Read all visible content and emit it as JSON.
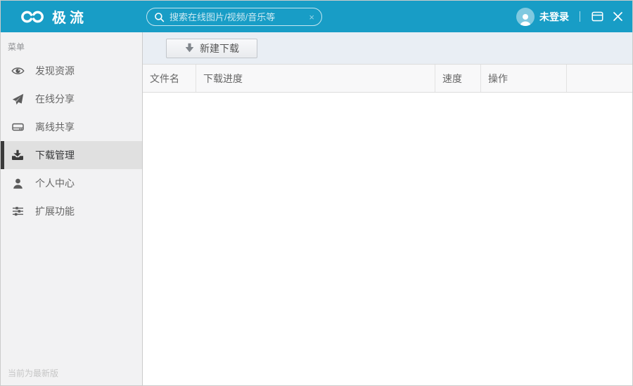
{
  "topbar": {
    "brand": "极流",
    "search": {
      "placeholder": "搜索在线图片/视频/音乐等",
      "clear_glyph": "×"
    },
    "login_label": "未登录"
  },
  "sidebar": {
    "section_label": "菜单",
    "items": [
      {
        "label": "发现资源",
        "icon": "eye-icon",
        "selected": false
      },
      {
        "label": "在线分享",
        "icon": "paper-plane-icon",
        "selected": false
      },
      {
        "label": "离线共享",
        "icon": "hard-drive-icon",
        "selected": false
      },
      {
        "label": "下载管理",
        "icon": "download-icon",
        "selected": true
      },
      {
        "label": "个人中心",
        "icon": "user-icon",
        "selected": false
      },
      {
        "label": "扩展功能",
        "icon": "sliders-icon",
        "selected": false
      }
    ],
    "footer_status": "当前为最新版"
  },
  "toolbar": {
    "new_download_label": "新建下载"
  },
  "table": {
    "columns": [
      {
        "label": "文件名"
      },
      {
        "label": "下载进度"
      },
      {
        "label": "速度"
      },
      {
        "label": "操作"
      },
      {
        "label": ""
      }
    ],
    "rows": []
  },
  "icons": {
    "logo": "infinity-rings-icon",
    "search": "magnifier-icon",
    "clear_search": "x-icon",
    "avatar": "person-icon",
    "window_control": "minimize-icon",
    "close": "close-icon",
    "menu_items": [
      "eye-icon",
      "paper-plane-icon",
      "hard-drive-icon",
      "download-icon",
      "user-icon",
      "sliders-icon"
    ],
    "new_download_arrow": "down-arrow-icon"
  },
  "colors": {
    "topbar_bg": "#189dc6",
    "sidebar_bg": "#f2f2f3",
    "sidebar_selected_bg": "#e0e0e0",
    "sidebar_selected_indicator": "#3a3a3a",
    "toolbar_bg": "#e9eef4",
    "table_header_bg": "#f8f8f9",
    "window_border": "#cbcbcb"
  }
}
